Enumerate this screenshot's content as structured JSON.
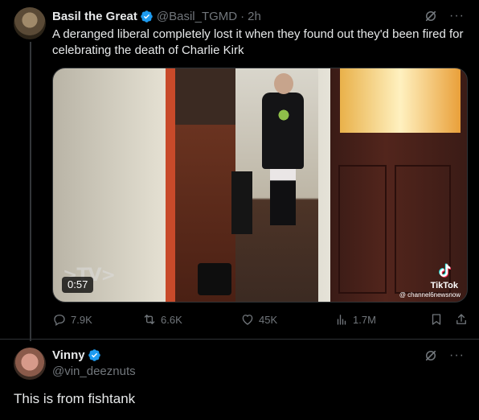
{
  "tweet": {
    "author_name": "Basil the Great",
    "handle": "@Basil_TGMD",
    "separator": "·",
    "time": "2h",
    "text": "A deranged liberal completely lost it when they found out they'd been fired for celebrating the death of Charlie Kirk",
    "media": {
      "watermark": ">TV>",
      "duration": "0:57",
      "tiktok_label": "TikTok",
      "tiktok_user": "@ channel6newsnow"
    },
    "actions": {
      "replies": "7.9K",
      "reposts": "6.6K",
      "likes": "45K",
      "views": "1.7M"
    },
    "more": "···"
  },
  "reply": {
    "author_name": "Vinny",
    "handle": "@vin_deeznuts",
    "text": "This is from fishtank",
    "more": "···"
  },
  "colors": {
    "background": "#000000",
    "text": "#e7e9ea",
    "secondary": "#71767b",
    "verified": "#1d9bf0",
    "border": "#2f3336"
  }
}
